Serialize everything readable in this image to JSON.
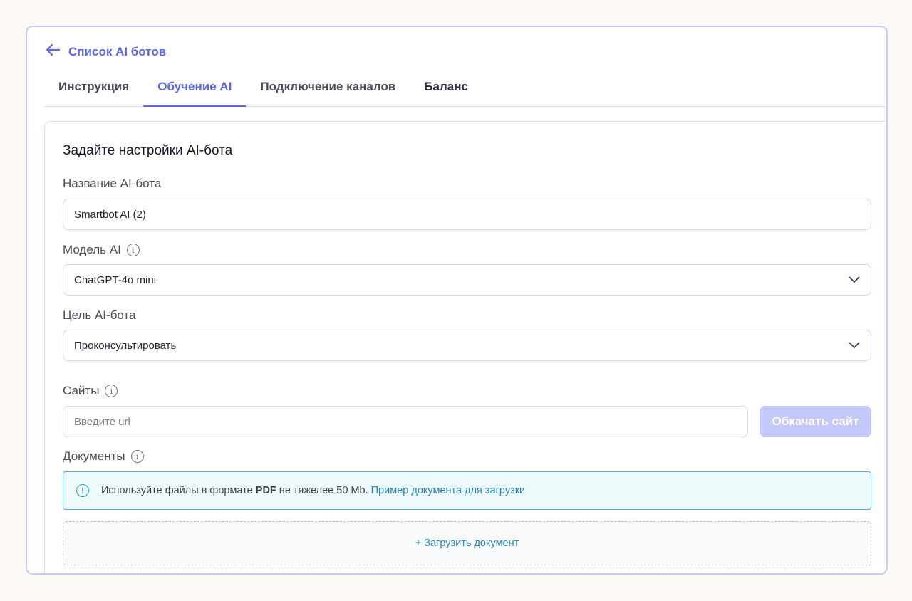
{
  "back_link": "Список AI ботов",
  "tabs": [
    "Инструкция",
    "Обучение AI",
    "Подключение каналов",
    "Баланс"
  ],
  "form": {
    "title": "Задайте настройки AI-бота",
    "name_label": "Название AI-бота",
    "name_value": "Smartbot AI (2)",
    "model_label": "Модель AI",
    "model_value": "ChatGPT-4o mini",
    "goal_label": "Цель AI-бота",
    "goal_value": "Проконсультировать",
    "sites_label": "Сайты",
    "sites_placeholder": "Введите url",
    "crawl_button": "Обкачать сайт",
    "docs_label": "Документы",
    "alert_text_1": "Используйте файлы в формате ",
    "alert_bold": "PDF",
    "alert_text_2": " не тяжелее 50 Mb. ",
    "alert_link": "Пример документа для загрузки",
    "upload_label": "+ Загрузить документ"
  }
}
